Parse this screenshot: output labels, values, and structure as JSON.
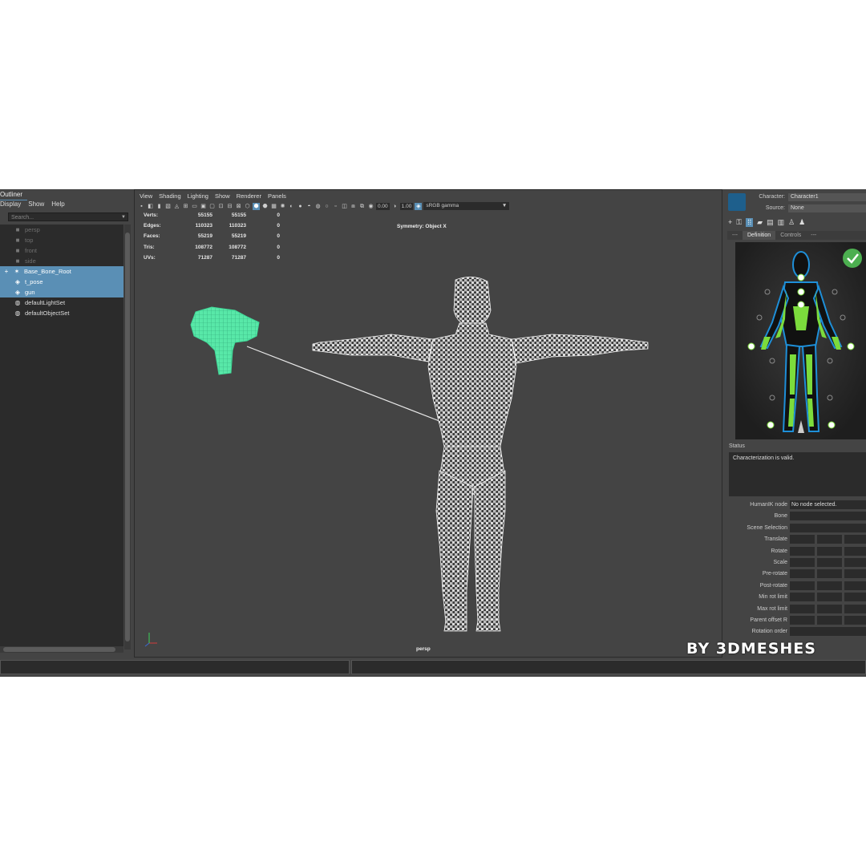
{
  "outliner": {
    "title": "Outliner",
    "menu": [
      "Display",
      "Show",
      "Help"
    ],
    "search_placeholder": "Search...",
    "items": [
      {
        "label": "persp",
        "icon": "camera-icon"
      },
      {
        "label": "top",
        "icon": "camera-icon"
      },
      {
        "label": "front",
        "icon": "camera-icon"
      },
      {
        "label": "side",
        "icon": "camera-icon"
      },
      {
        "label": "Base_Bone_Root",
        "icon": "joint-icon"
      },
      {
        "label": "t_pose",
        "icon": "mesh-icon"
      },
      {
        "label": "gun",
        "icon": "mesh-icon"
      },
      {
        "label": "defaultLightSet",
        "icon": "set-icon"
      },
      {
        "label": "defaultObjectSet",
        "icon": "set-icon"
      }
    ]
  },
  "viewport": {
    "menu": [
      "View",
      "Shading",
      "Lighting",
      "Show",
      "Renderer",
      "Panels"
    ],
    "exposure": "0.00",
    "gamma": "1.00",
    "color_space": "sRGB gamma",
    "hud": {
      "rows": [
        {
          "label": "Verts:",
          "v1": "55155",
          "v2": "55155",
          "v3": "0"
        },
        {
          "label": "Edges:",
          "v1": "110323",
          "v2": "110323",
          "v3": "0"
        },
        {
          "label": "Faces:",
          "v1": "55219",
          "v2": "55219",
          "v3": "0"
        },
        {
          "label": "Tris:",
          "v1": "108772",
          "v2": "108772",
          "v3": "0"
        },
        {
          "label": "UVs:",
          "v1": "71287",
          "v2": "71287",
          "v3": "0"
        }
      ]
    },
    "symmetry": "Symmetry: Object X",
    "camera": "persp"
  },
  "hik": {
    "character_label": "Character:",
    "character_value": "Character1",
    "source_label": "Source:",
    "source_value": "None",
    "tabs": [
      "---",
      "Definition",
      "Controls",
      "---"
    ],
    "status_title": "Status",
    "status_text": "Characterization is valid.",
    "properties": [
      {
        "label": "HumanIK node",
        "value": "No node selected."
      },
      {
        "label": "Bone",
        "value": ""
      },
      {
        "label": "Scene Selection",
        "value": ""
      },
      {
        "label": "Translate",
        "value": ""
      },
      {
        "label": "Rotate",
        "value": ""
      },
      {
        "label": "Scale",
        "value": ""
      },
      {
        "label": "Pre-rotate",
        "value": ""
      },
      {
        "label": "Post-rotate",
        "value": ""
      },
      {
        "label": "Min rot limit",
        "value": ""
      },
      {
        "label": "Max rot limit",
        "value": ""
      },
      {
        "label": "Parent offset R",
        "value": ""
      },
      {
        "label": "Rotation order",
        "value": ""
      }
    ],
    "colors": {
      "bone_green": "#7cdc3c",
      "outline_blue": "#1e8fd8",
      "valid_green": "#4caf50"
    }
  },
  "watermark": "BY 3DMESHES",
  "colors": {
    "app_bg": "#444444",
    "selection": "#5a8fb5",
    "gun_color": "#50e0a0"
  }
}
